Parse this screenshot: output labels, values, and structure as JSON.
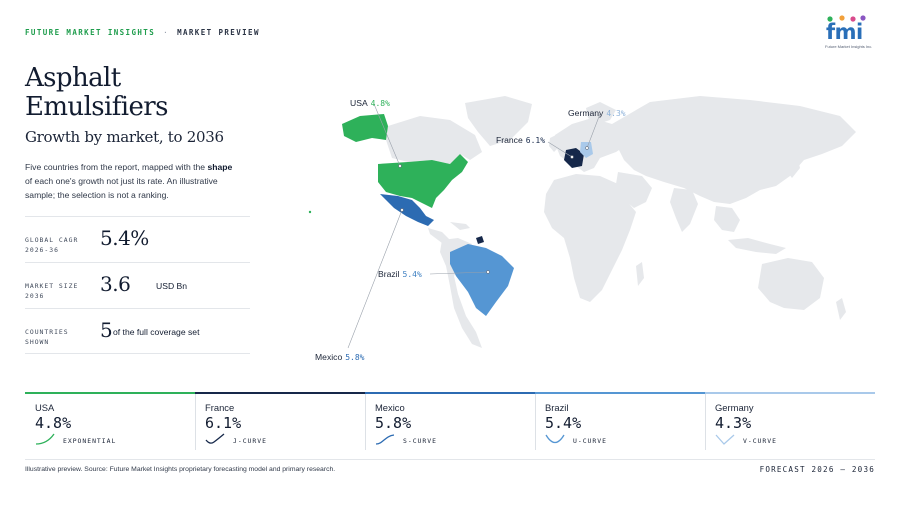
{
  "header": {
    "brand": "FUTURE MARKET INSIGHTS",
    "separator": "·",
    "section": "MARKET PREVIEW",
    "logo_letters": "fmi",
    "logo_tagline": "Future Market Insights Inc."
  },
  "title_line1": "Asphalt",
  "title_line2": "Emulsifiers",
  "subtitle": "Growth by market, to 2036",
  "intro": {
    "before": "Five countries from the report, mapped with the ",
    "bold": "shape",
    "after": " of each one's growth not just its rate. An illustrative sample; the selection is not a ranking."
  },
  "stats": [
    {
      "label_line1": "GLOBAL CAGR",
      "label_line2": "2026-36",
      "value": "5.4%",
      "unit": ""
    },
    {
      "label_line1": "MARKET SIZE",
      "label_line2": "2036",
      "value": "3.6",
      "unit": "USD Bn"
    },
    {
      "label_line1": "COUNTRIES",
      "label_line2": "SHOWN",
      "value": "5",
      "unit": "of the full coverage set"
    }
  ],
  "chart_data": {
    "type": "map",
    "title": "Asphalt Emulsifiers",
    "subtitle": "Growth by market, to 2036",
    "countries": [
      {
        "name": "USA",
        "cagr": 4.8,
        "rate_label": "4.8%",
        "shape": "EXPONENTIAL",
        "color": "#2eb15a"
      },
      {
        "name": "France",
        "cagr": 6.1,
        "rate_label": "6.1%",
        "shape": "J-CURVE",
        "color": "#16284a"
      },
      {
        "name": "Mexico",
        "cagr": 5.8,
        "rate_label": "5.8%",
        "shape": "S-CURVE",
        "color": "#2c6bb2"
      },
      {
        "name": "Brazil",
        "cagr": 5.4,
        "rate_label": "5.4%",
        "shape": "U-CURVE",
        "color": "#5596d3"
      },
      {
        "name": "Germany",
        "cagr": 4.3,
        "rate_label": "4.3%",
        "shape": "V-CURVE",
        "color": "#a9c9ea"
      }
    ]
  },
  "colors": {
    "land": "#e6e8eb",
    "usa": "#2eb15a",
    "france": "#16284a",
    "mexico": "#2c6bb2",
    "brazil": "#5596d3",
    "germany": "#a9c9ea",
    "brand_green": "#1f9d4d"
  },
  "footer": {
    "note": "Illustrative preview. Source: Future Market Insights proprietary forecasting model and primary research.",
    "forecast": "FORECAST 2026 – 2036"
  }
}
